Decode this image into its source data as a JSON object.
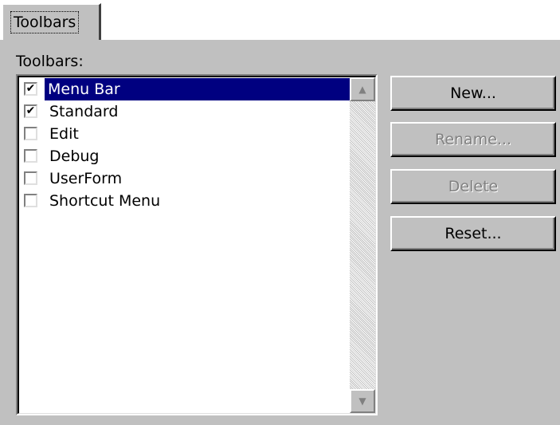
{
  "tab": {
    "label": "Toolbars"
  },
  "toolbars_label": "Toolbars:",
  "toolbar_items": [
    {
      "label": "Menu Bar",
      "checked": true,
      "selected": true
    },
    {
      "label": "Standard",
      "checked": true,
      "selected": false
    },
    {
      "label": "Edit",
      "checked": false,
      "selected": false
    },
    {
      "label": "Debug",
      "checked": false,
      "selected": false
    },
    {
      "label": "UserForm",
      "checked": false,
      "selected": false
    },
    {
      "label": "Shortcut Menu",
      "checked": false,
      "selected": false
    }
  ],
  "buttons": {
    "new": {
      "label": "New...",
      "enabled": true
    },
    "rename": {
      "label": "Rename...",
      "enabled": false
    },
    "delete": {
      "label": "Delete",
      "enabled": false
    },
    "reset": {
      "label": "Reset...",
      "enabled": true
    }
  },
  "icons": {
    "scroll_up": "scroll-up-arrow-icon",
    "scroll_down": "scroll-down-arrow-icon",
    "check": "checkmark-icon"
  },
  "colors": {
    "face": "#c0c0c0",
    "selection": "#000080",
    "disabled_text": "#808080"
  }
}
